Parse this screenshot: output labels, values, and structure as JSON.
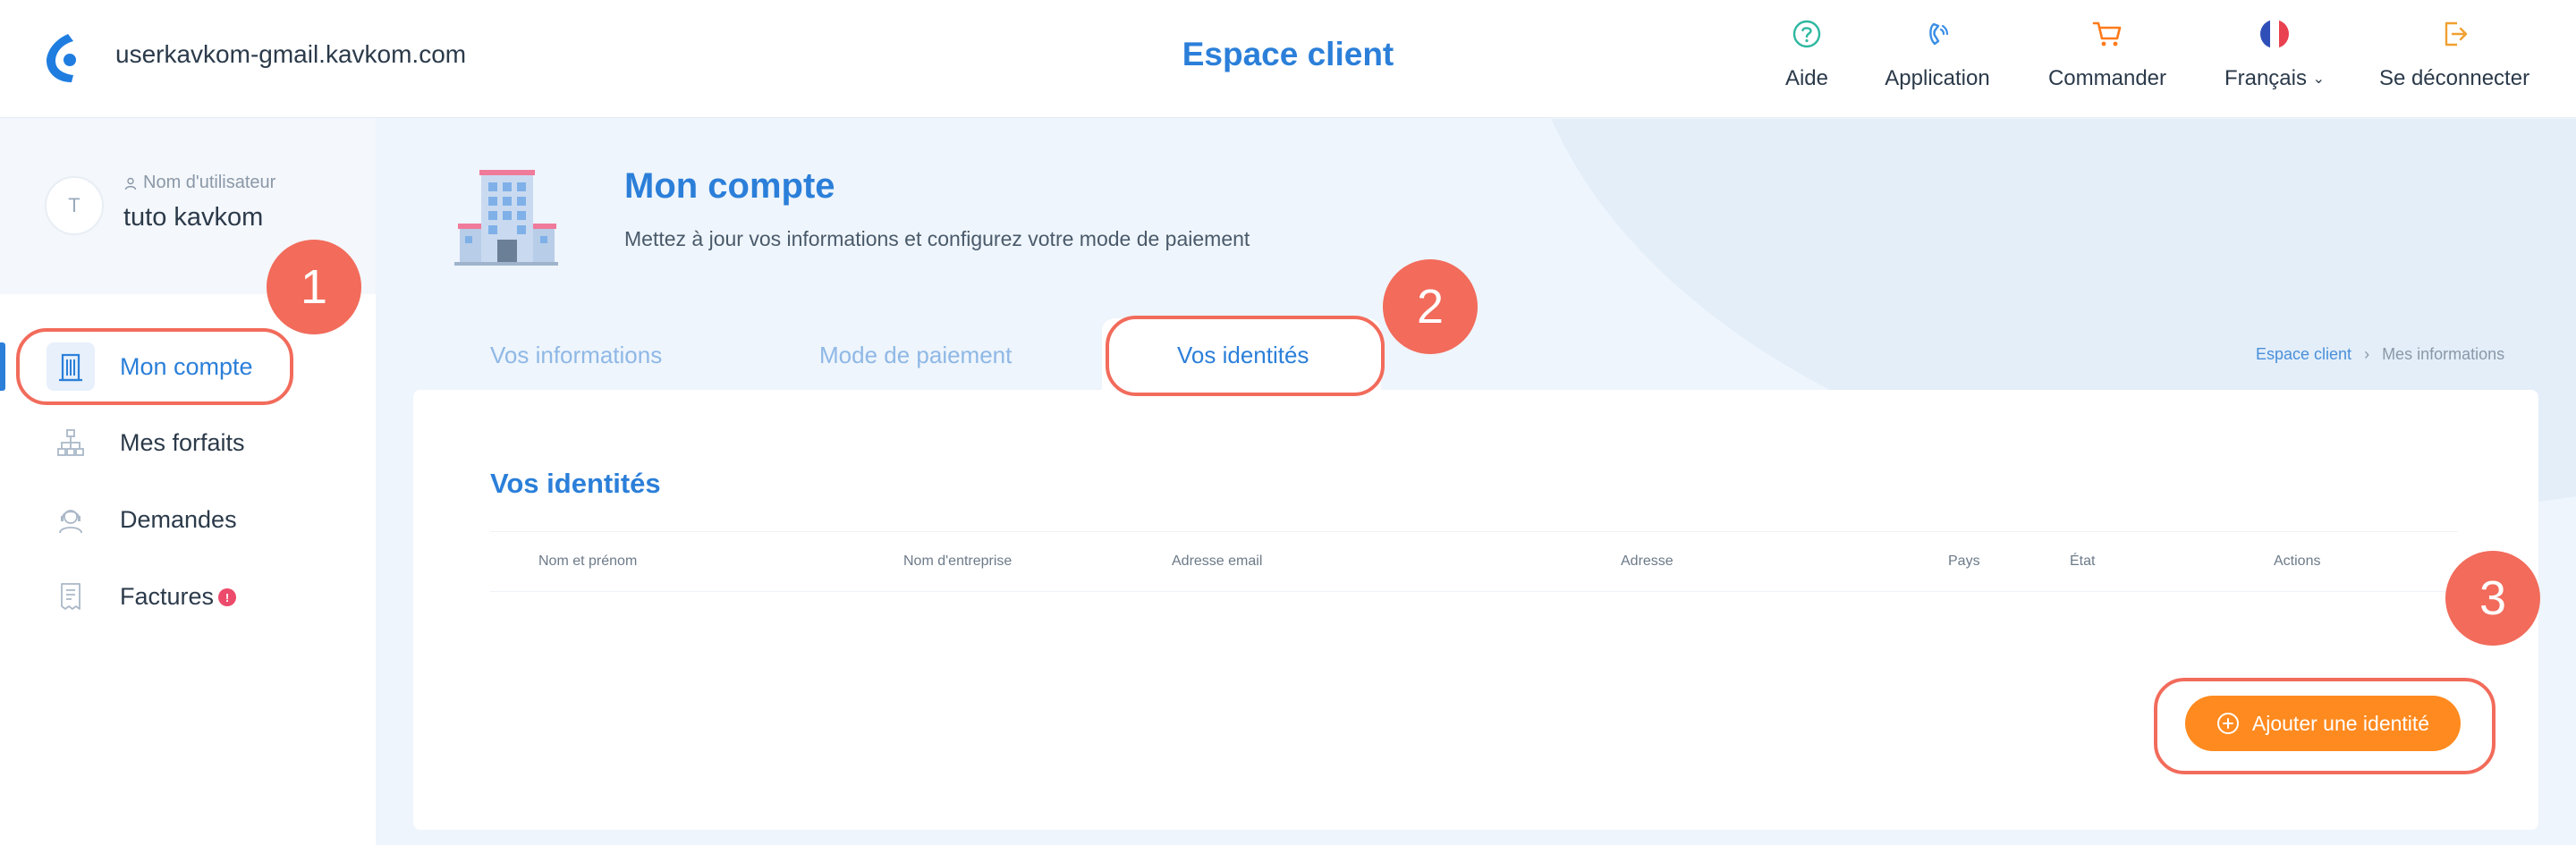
{
  "header": {
    "account": "userkavkom-gmail.kavkom.com",
    "title": "Espace client",
    "nav": {
      "help": "Aide",
      "application": "Application",
      "order": "Commander",
      "language": "Français",
      "logout": "Se déconnecter"
    }
  },
  "user": {
    "avatar_initial": "T",
    "caption": "Nom d'utilisateur",
    "name": "tuto kavkom"
  },
  "sidebar": {
    "items": [
      {
        "label": "Mon compte",
        "active": true
      },
      {
        "label": "Mes forfaits"
      },
      {
        "label": "Demandes"
      },
      {
        "label": "Factures",
        "badge": "!"
      }
    ]
  },
  "page": {
    "title": "Mon compte",
    "subtitle": "Mettez à jour vos informations et configurez votre mode de paiement"
  },
  "tabs": [
    "Vos informations",
    "Mode de paiement",
    "Vos identités"
  ],
  "breadcrumb": {
    "home": "Espace client",
    "current": "Mes informations"
  },
  "card": {
    "title": "Vos identités",
    "columns": [
      "Nom et prénom",
      "Nom d'entreprise",
      "Adresse email",
      "Adresse",
      "Pays",
      "État",
      "Actions"
    ],
    "add_button": "Ajouter une identité"
  },
  "steps": [
    "1",
    "2",
    "3"
  ],
  "colors": {
    "primary": "#2b7fd9",
    "accent": "#ff8a1f",
    "annotation": "#f26b5b"
  }
}
